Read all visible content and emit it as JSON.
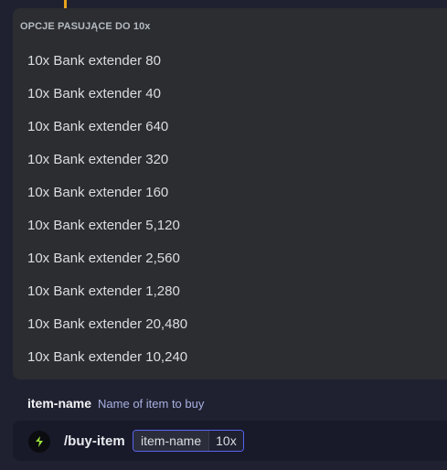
{
  "autocomplete": {
    "header": "OPCJE PASUJĄCE DO 10x",
    "options": [
      "10x Bank extender 80",
      "10x Bank extender 40",
      "10x Bank extender 640",
      "10x Bank extender 320",
      "10x Bank extender 160",
      "10x Bank extender 5,120",
      "10x Bank extender 2,560",
      "10x Bank extender 1,280",
      "10x Bank extender 20,480",
      "10x Bank extender 10,240"
    ]
  },
  "parameter": {
    "name": "item-name",
    "description": "Name of item to buy"
  },
  "input": {
    "bot_icon": "bot-avatar-icon",
    "command": "/buy-item",
    "option_label": "item-name",
    "option_value": "10x"
  },
  "colors": {
    "accent_line": "#e7a21d",
    "chip_border": "#5865f2",
    "popup_bg": "#2b2d31",
    "input_bg": "#181929",
    "param_description": "#a7b0e0"
  }
}
